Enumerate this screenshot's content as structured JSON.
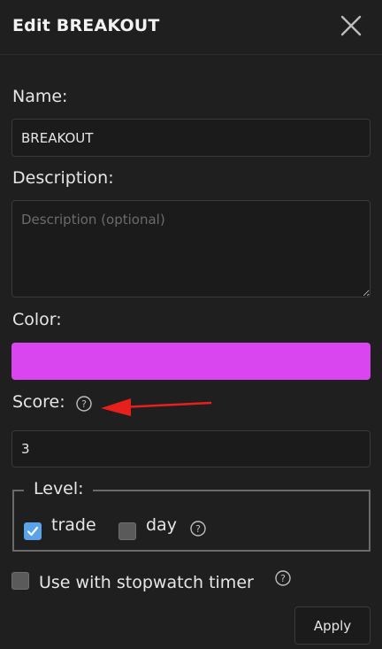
{
  "header": {
    "title": "Edit BREAKOUT",
    "close_icon": "close-icon"
  },
  "form": {
    "name_label": "Name:",
    "name_value": "BREAKOUT",
    "description_label": "Description:",
    "description_placeholder": "Description (optional)",
    "description_value": "",
    "color_label": "Color:",
    "color_value": "#d946ef",
    "score_label": "Score:",
    "score_value": "3",
    "level": {
      "legend": "Level:",
      "trade_label": "trade",
      "trade_checked": true,
      "day_label": "day",
      "day_checked": false
    },
    "stopwatch_label": "Use with stopwatch timer",
    "stopwatch_checked": false,
    "apply_label": "Apply"
  },
  "annotation": {
    "arrow_color": "#e8201c"
  },
  "colors": {
    "background": "#1f1f1f",
    "checkbox_checked": "#5aa3e8"
  }
}
